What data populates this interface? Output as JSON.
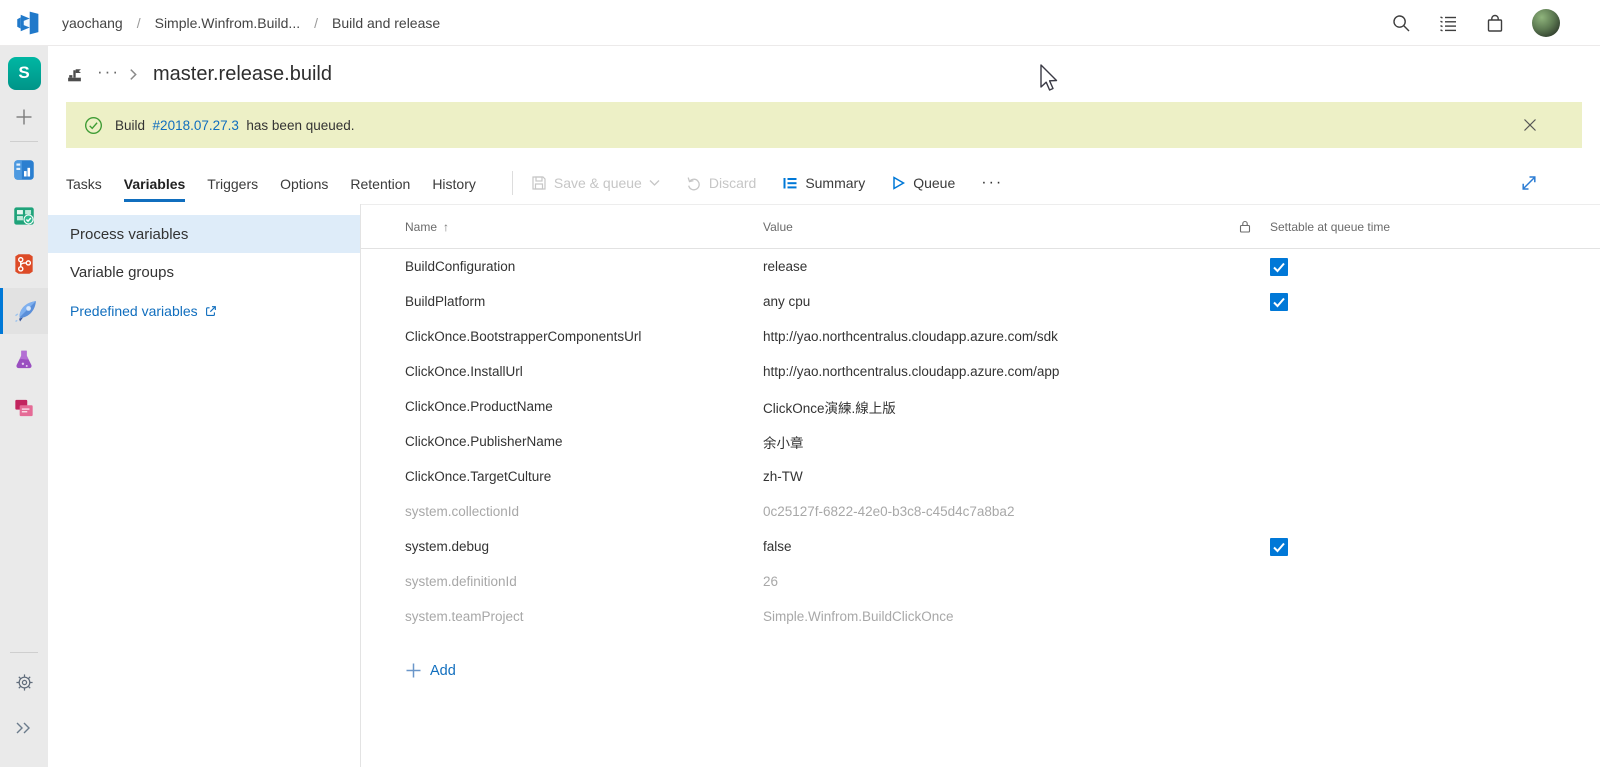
{
  "colors": {
    "accent": "#0078d7",
    "link": "#106ebe",
    "banner_bg": "#edf0c6",
    "rail_bg": "#eaeaea",
    "selected_bg": "#deecf9",
    "check_green": "#3f9c35"
  },
  "topbar": {
    "separator": "/",
    "breadcrumb": [
      {
        "label": "yaochang"
      },
      {
        "label": "Simple.Winfrom.Build..."
      },
      {
        "label": "Build and release"
      }
    ],
    "icons": [
      "search-icon",
      "work-list-icon",
      "marketplace-bag-icon",
      "user-avatar"
    ]
  },
  "sidebar": {
    "project_tile_letter": "S",
    "items": [
      "project-tile",
      "add-project",
      "overview",
      "boards",
      "repos",
      "pipelines",
      "test-plans",
      "artifacts",
      "settings",
      "expand"
    ]
  },
  "page": {
    "title": "master.release.build",
    "ellipsis": "···",
    "definition_icon": "build-definition-icon"
  },
  "banner": {
    "prefix": "Build",
    "build_link": "#2018.07.27.3",
    "suffix": "has been queued."
  },
  "tabs": [
    {
      "label": "Tasks",
      "active": false
    },
    {
      "label": "Variables",
      "active": true
    },
    {
      "label": "Triggers",
      "active": false
    },
    {
      "label": "Options",
      "active": false
    },
    {
      "label": "Retention",
      "active": false
    },
    {
      "label": "History",
      "active": false
    }
  ],
  "toolbar": {
    "save_queue_label": "Save & queue",
    "discard_label": "Discard",
    "summary_label": "Summary",
    "queue_label": "Queue",
    "more_label": "···",
    "save_queue_disabled": true,
    "discard_disabled": true
  },
  "panel": {
    "items": [
      {
        "label": "Process variables",
        "selected": true
      },
      {
        "label": "Variable groups",
        "selected": false
      }
    ],
    "link_label": "Predefined variables"
  },
  "table": {
    "headers": {
      "name": "Name",
      "sort": "↑",
      "value": "Value",
      "lock": "lock-icon",
      "settable": "Settable at queue time"
    },
    "rows": [
      {
        "name": "BuildConfiguration",
        "value": "release",
        "settable": true,
        "readonly": false
      },
      {
        "name": "BuildPlatform",
        "value": "any cpu",
        "settable": true,
        "readonly": false
      },
      {
        "name": "ClickOnce.BootstrapperComponentsUrl",
        "value": "http://yao.northcentralus.cloudapp.azure.com/sdk",
        "settable": false,
        "readonly": false
      },
      {
        "name": "ClickOnce.InstallUrl",
        "value": "http://yao.northcentralus.cloudapp.azure.com/app",
        "settable": false,
        "readonly": false
      },
      {
        "name": "ClickOnce.ProductName",
        "value": "ClickOnce演練.線上版",
        "settable": false,
        "readonly": false
      },
      {
        "name": "ClickOnce.PublisherName",
        "value": "余小章",
        "settable": false,
        "readonly": false
      },
      {
        "name": "ClickOnce.TargetCulture",
        "value": "zh-TW",
        "settable": false,
        "readonly": false
      },
      {
        "name": "system.collectionId",
        "value": "0c25127f-6822-42e0-b3c8-c45d4c7a8ba2",
        "settable": false,
        "readonly": true
      },
      {
        "name": "system.debug",
        "value": "false",
        "settable": true,
        "readonly": false
      },
      {
        "name": "system.definitionId",
        "value": "26",
        "settable": false,
        "readonly": true
      },
      {
        "name": "system.teamProject",
        "value": "Simple.Winfrom.BuildClickOnce",
        "settable": false,
        "readonly": true
      }
    ],
    "add_label": "Add"
  }
}
